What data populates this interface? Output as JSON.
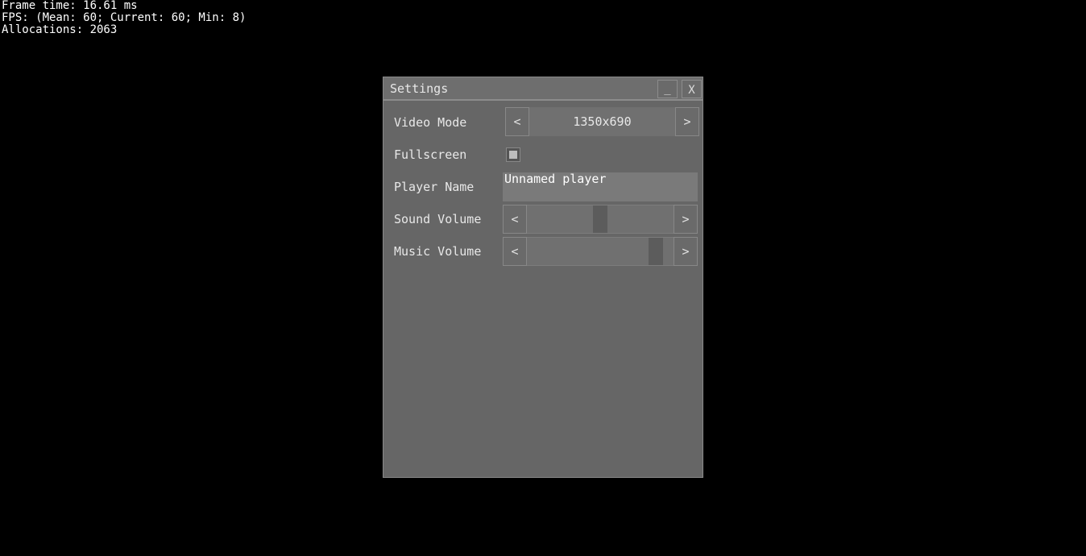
{
  "stats": {
    "frame_time": "Frame time: 16.61 ms",
    "fps": "FPS: (Mean: 60; Current: 60; Min: 8)",
    "allocations": "Allocations: 2063"
  },
  "window": {
    "title": "Settings",
    "minimize_label": "_",
    "close_label": "X"
  },
  "settings": {
    "video_mode": {
      "label": "Video Mode",
      "value": "1350x690",
      "prev": "<",
      "next": ">"
    },
    "fullscreen": {
      "label": "Fullscreen",
      "checked": false
    },
    "player_name": {
      "label": "Player Name",
      "value": "Unnamed player"
    },
    "sound_volume": {
      "label": "Sound Volume",
      "prev": "<",
      "next": ">",
      "level": 0.5
    },
    "music_volume": {
      "label": "Music Volume",
      "prev": "<",
      "next": ">",
      "level": 0.92
    }
  },
  "colors": {
    "background": "#000000",
    "window": "#666666",
    "text": "#e8e8e8"
  }
}
